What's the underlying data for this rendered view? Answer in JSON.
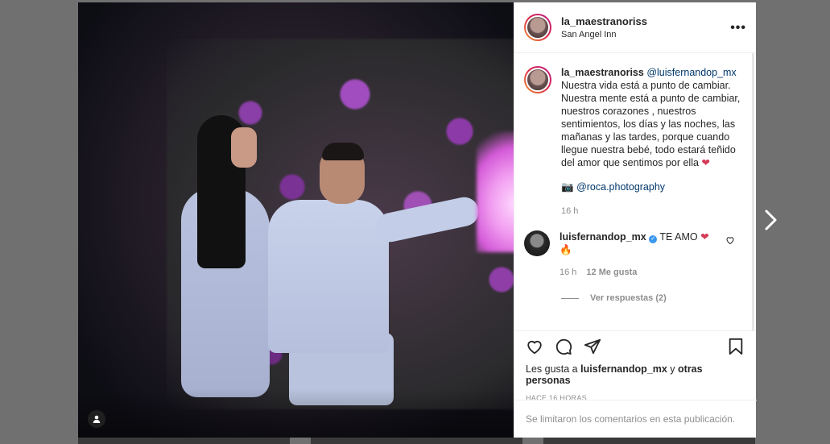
{
  "post": {
    "username": "la_maestranoriss",
    "location": "San Angel Inn",
    "more_label": "•••",
    "caption": {
      "username": "la_maestranoriss",
      "mention": "@luisfernandop_mx",
      "text": "Nuestra vida está a punto de cambiar. Nuestra mente está a punto de cambiar, nuestros corazones , nuestros sentimientos, los días y las noches, las mañanas y las tardes, porque cuando llegue nuestra bebé, todo estará teñido del amor que sentimos por ella",
      "heart": "❤",
      "camera_emoji": "📷",
      "photographer": "@roca.photography",
      "time": "16 h"
    },
    "comment": {
      "username": "luisfernandop_mx",
      "verified": "✓",
      "text": "TE AMO",
      "heart": "❤",
      "fire": "🔥",
      "time": "16 h",
      "likes": "12 Me gusta",
      "replies": "Ver respuestas (2)"
    },
    "likes": {
      "prefix": "Les gusta a",
      "user": "luisfernandop_mx",
      "joiner": "y",
      "others": "otras personas"
    },
    "date": "HACE 16 HORAS",
    "comments_limited": "Se limitaron los comentarios en esta publicación."
  },
  "icons": {
    "like": "heart-icon",
    "comment": "comment-icon",
    "share": "send-icon",
    "save": "bookmark-icon",
    "tag": "user-icon",
    "next": "chevron-right-icon"
  },
  "colors": {
    "mention": "#00376b",
    "muted": "#8e8e8e",
    "verified": "#3897f0",
    "heart": "#d43a55"
  }
}
